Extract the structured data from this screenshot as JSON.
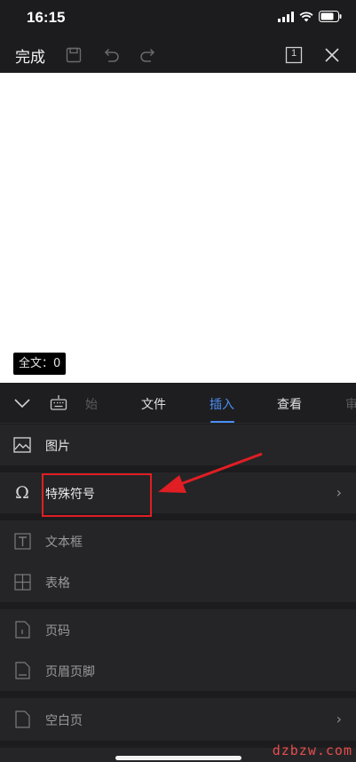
{
  "status_bar": {
    "time": "16:15"
  },
  "toolbar": {
    "done_label": "完成",
    "page_number": "1"
  },
  "document": {
    "word_count_label": "全文：0"
  },
  "tabs": [
    {
      "label": "始",
      "state": "faded"
    },
    {
      "label": "文件",
      "state": "normal"
    },
    {
      "label": "插入",
      "state": "active"
    },
    {
      "label": "查看",
      "state": "normal"
    },
    {
      "label": "审",
      "state": "faded"
    }
  ],
  "menu": {
    "image": "图片",
    "special_symbol": "特殊符号",
    "text_box": "文本框",
    "table": "表格",
    "page_number": "页码",
    "header_footer": "页眉页脚",
    "blank_page": "空白页"
  },
  "watermark": "dzbzw.com",
  "colors": {
    "accent": "#4a8ef7",
    "annotation": "#e01e24"
  }
}
